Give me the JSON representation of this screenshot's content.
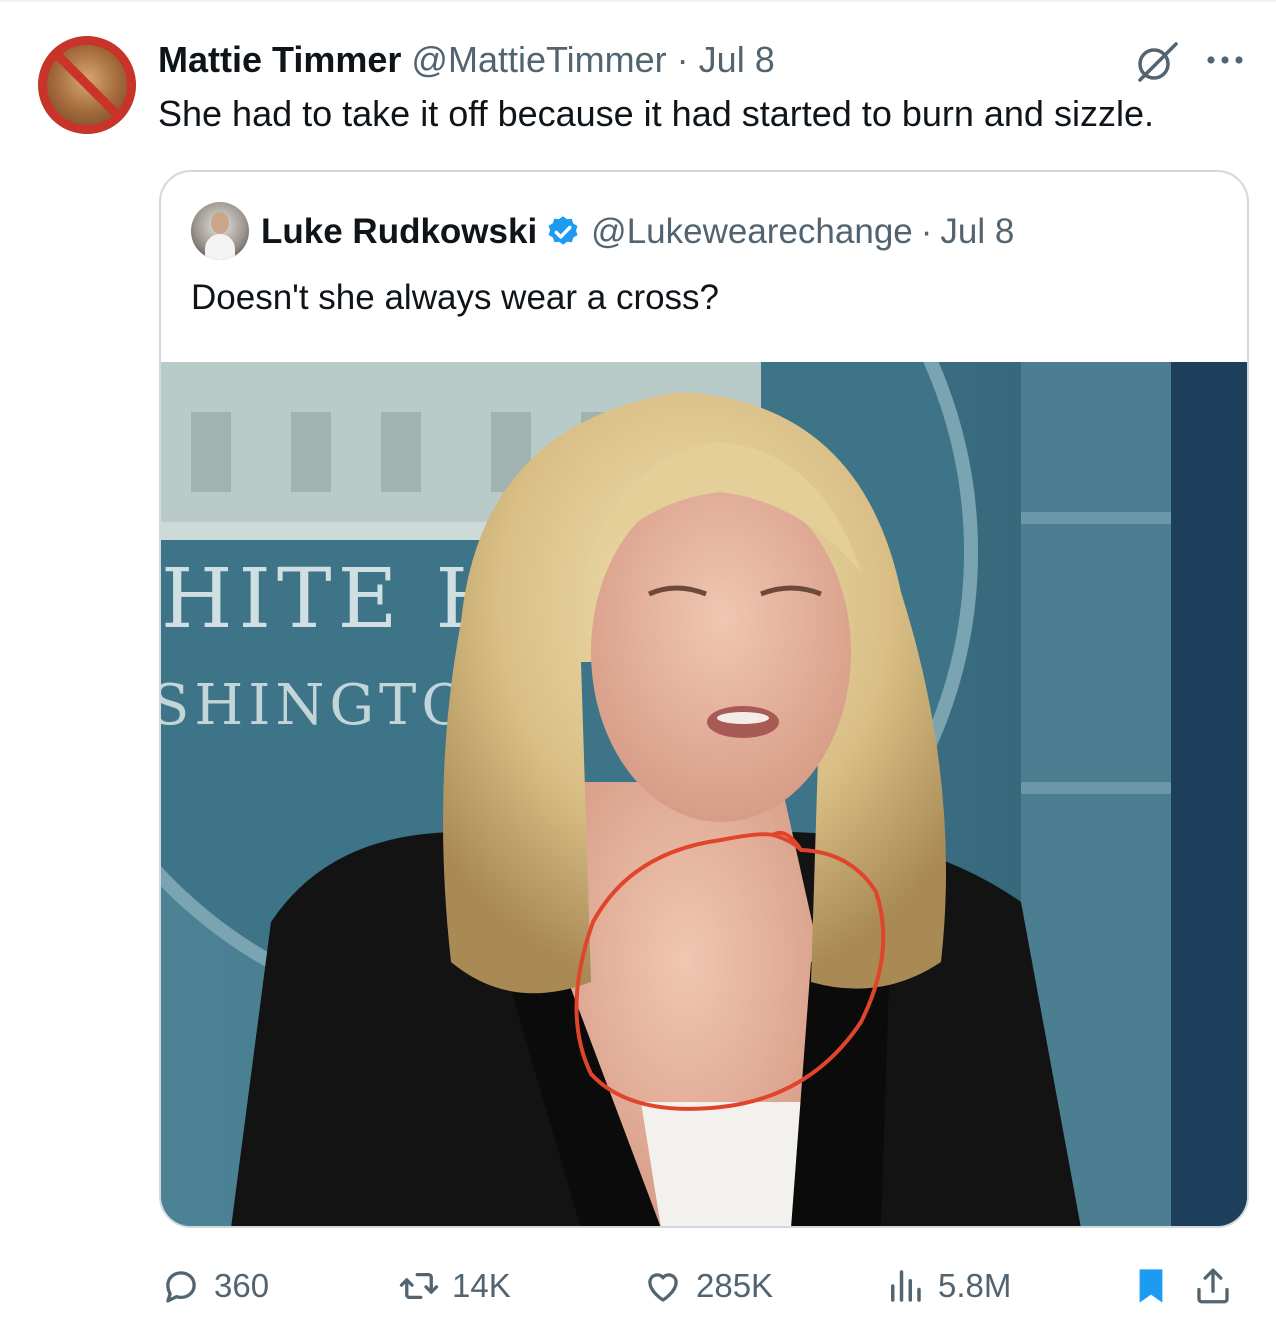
{
  "tweet": {
    "author_name": "Mattie Timmer",
    "author_handle": "@MattieTimmer",
    "separator": "·",
    "date": "Jul 8",
    "text": "She had to take it off because it had started to burn and sizzle.",
    "avatar_icon": "no-symbol-avatar"
  },
  "quoted_tweet": {
    "author_name": "Luke Rudkowski",
    "verified": true,
    "verified_color": "#1d9bf0",
    "author_handle": "@Lukewearechange",
    "separator": "·",
    "date": "Jul 8",
    "text": "Doesn't she always wear a cross?",
    "media": {
      "sign_line_1": "HITE H",
      "sign_line_2": "SHINGTO",
      "annotation_color": "#e0452c"
    }
  },
  "actions": {
    "reply_count": "360",
    "repost_count": "14K",
    "like_count": "285K",
    "view_count": "5.8M",
    "bookmark_active_color": "#1d9bf0",
    "icons": [
      "reply-icon",
      "repost-icon",
      "like-icon",
      "views-icon",
      "bookmark-icon",
      "share-icon"
    ]
  },
  "header_icons": [
    "grok-icon",
    "more-icon"
  ]
}
